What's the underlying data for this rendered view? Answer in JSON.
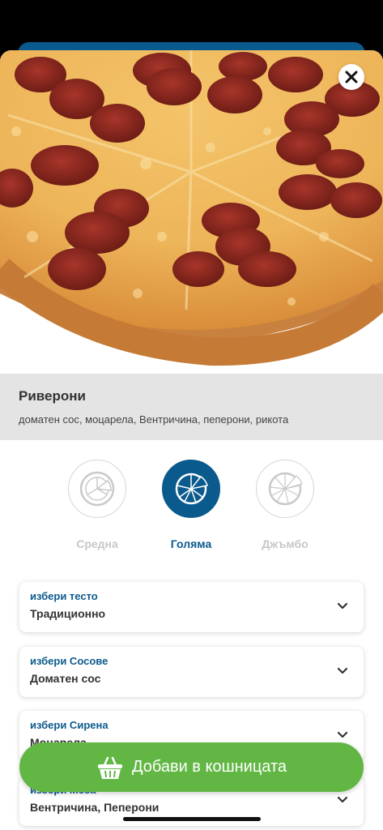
{
  "product": {
    "name": "Риверони",
    "ingredients": "доматен сос, моцарела, Вентричина, пеперони, рикота"
  },
  "sizes": [
    {
      "label": "Средна",
      "selected": false
    },
    {
      "label": "Голяма",
      "selected": true
    },
    {
      "label": "Джъмбо",
      "selected": false
    }
  ],
  "options": [
    {
      "title": "избери тесто",
      "value": "Традиционно"
    },
    {
      "title": "избери Сосове",
      "value": "Доматен сос"
    },
    {
      "title": "избери Сирена",
      "value": "Моцарела"
    },
    {
      "title": "избери Меса",
      "value": "Вентричина, Пеперони"
    }
  ],
  "cart_button": {
    "label": "Добави в кошницата"
  },
  "colors": {
    "brand": "#0b5a8e",
    "cta": "#62b744"
  },
  "icons": {
    "close": "close-icon",
    "basket": "basket-icon",
    "chevron": "chevron-down-icon"
  }
}
